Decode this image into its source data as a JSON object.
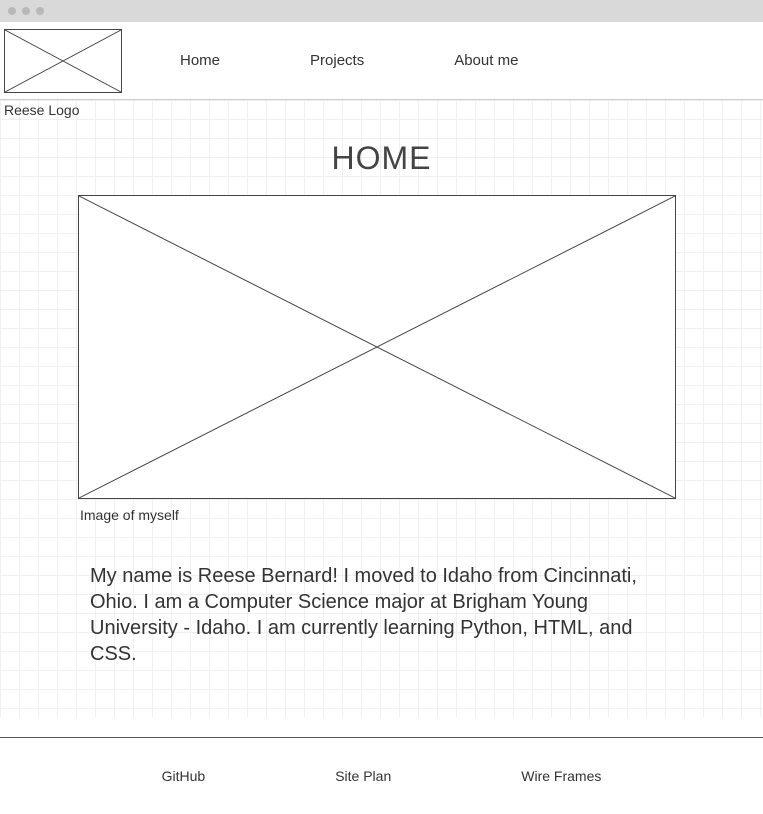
{
  "header": {
    "logo_caption": "Reese Logo",
    "nav": [
      "Home",
      "Projects",
      "About me"
    ]
  },
  "page": {
    "title": "HOME",
    "image_caption": "Image of myself",
    "intro": "My name is Reese Bernard! I moved to Idaho from Cincinnati, Ohio. I am a Computer Science major at Brigham Young University - Idaho. I am currently learning Python, HTML, and CSS."
  },
  "footer": {
    "links": [
      "GitHub",
      "Site Plan",
      "Wire Frames"
    ]
  }
}
